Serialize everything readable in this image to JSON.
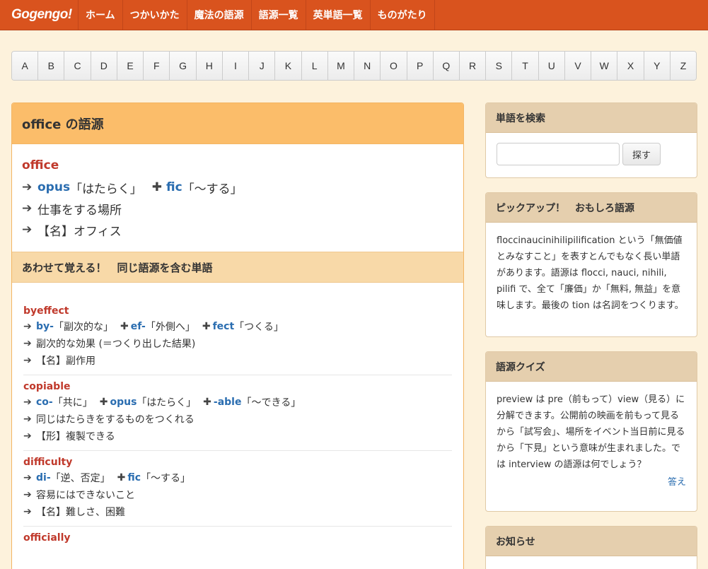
{
  "nav": {
    "brand": "Gogengo!",
    "items": [
      "ホーム",
      "つかいかた",
      "魔法の語源",
      "語源一覧",
      "英単語一覧",
      "ものがたり"
    ]
  },
  "alphabet": [
    "A",
    "B",
    "C",
    "D",
    "E",
    "F",
    "G",
    "H",
    "I",
    "J",
    "K",
    "L",
    "M",
    "N",
    "O",
    "P",
    "Q",
    "R",
    "S",
    "T",
    "U",
    "V",
    "W",
    "X",
    "Y",
    "Z"
  ],
  "main": {
    "heading": "office の語源",
    "word": "office",
    "etymology": {
      "root1": "opus",
      "root1_meaning": "「はたらく」",
      "root2": "fic",
      "root2_meaning": "「〜する」"
    },
    "meaning": "仕事をする場所",
    "definition": "【名】オフィス",
    "related_heading": "あわせて覚える！　同じ語源を含む単語",
    "related": [
      {
        "word": "byeffect",
        "parts": [
          {
            "root": "by-",
            "meaning": "「副次的な」"
          },
          {
            "root": "ef-",
            "meaning": "「外側へ」"
          },
          {
            "root": "fect",
            "meaning": "「つくる」"
          }
        ],
        "meaning": "副次的な効果 (＝つくり出した結果)",
        "definition": "【名】副作用"
      },
      {
        "word": "copiable",
        "parts": [
          {
            "root": "co-",
            "meaning": "「共に」"
          },
          {
            "root": "opus",
            "meaning": "「はたらく」"
          },
          {
            "root": "-able",
            "meaning": "「〜できる」"
          }
        ],
        "meaning": "同じはたらきをするものをつくれる",
        "definition": "【形】複製できる"
      },
      {
        "word": "difficulty",
        "parts": [
          {
            "root": "di-",
            "meaning": "「逆、否定」"
          },
          {
            "root": "fic",
            "meaning": "「〜する」"
          }
        ],
        "meaning": "容易にはできないこと",
        "definition": "【名】難しさ、困難"
      },
      {
        "word": "officially",
        "parts": [],
        "meaning": "",
        "definition": ""
      }
    ]
  },
  "sidebar": {
    "search_title": "単語を検索",
    "search_button": "探す",
    "pickup_title": "ピックアップ！　おもしろ語源",
    "pickup_text": "floccinaucinihilipilification という「無価値とみなすこと」を表すとんでもなく長い単語があります。語源は flocci, nauci, nihili, pilifi で、全て「廉価」か「無料, 無益」を意味します。最後の tion は名詞をつくります。",
    "quiz_title": "語源クイズ",
    "quiz_text": "preview は pre（前もって）view（見る）に分解できます。公開前の映画を前もって見るから「試写会」、場所をイベント当日前に見るから「下見」という意味が生まれました。では interview の語源は何でしょう？",
    "quiz_answer": "答え",
    "news_title": "お知らせ"
  }
}
